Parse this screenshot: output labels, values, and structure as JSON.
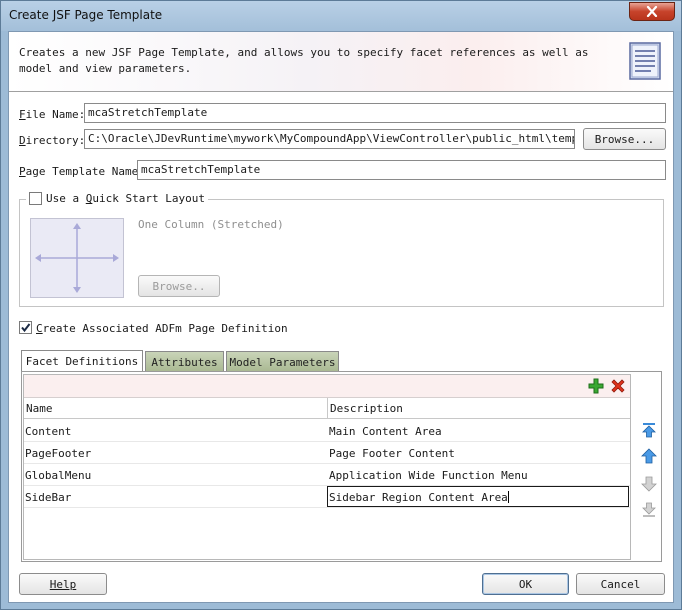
{
  "window": {
    "title": "Create JSF Page Template"
  },
  "header": {
    "description": "Creates a new JSF Page Template, and allows you to specify facet references as well as model and view parameters."
  },
  "file_name": {
    "label_key": "F",
    "label_rest": "ile Name:",
    "value": "mcaStretchTemplate"
  },
  "directory": {
    "label_key": "D",
    "label_rest": "irectory:",
    "value": "C:\\Oracle\\JDevRuntime\\mywork\\MyCompoundApp\\ViewController\\public_html\\templates",
    "browse_label": "Browse..."
  },
  "page_template_name": {
    "label_key": "P",
    "label_rest": "age Template Name:",
    "value": "mcaStretchTemplate"
  },
  "quick_start": {
    "label_pre": "Use a ",
    "label_key": "Q",
    "label_rest": "uick Start Layout",
    "checked": false,
    "layout_name": "One Column (Stretched)",
    "browse_label": "Browse.."
  },
  "adfm": {
    "label_key": "C",
    "label_rest": "reate Associated ADFm Page Definition",
    "checked": true
  },
  "tabs": [
    {
      "label": "Facet Definitions",
      "active": true
    },
    {
      "label": "Attributes",
      "active": false
    },
    {
      "label": "Model Parameters",
      "active": false
    }
  ],
  "table": {
    "columns": [
      "Name",
      "Description"
    ],
    "rows": [
      {
        "name": "Content",
        "description": "Main Content Area"
      },
      {
        "name": "PageFooter",
        "description": "Page Footer Content"
      },
      {
        "name": "GlobalMenu",
        "description": "Application Wide Function Menu"
      },
      {
        "name": "SideBar",
        "description": "Sidebar Region Content Area"
      }
    ]
  },
  "footer": {
    "help_label": "Help",
    "ok_label": "OK",
    "cancel_label": "Cancel"
  },
  "colors": {
    "titlebar": "#a9c4dd",
    "close": "#c7432b",
    "tab_inactive": "#b3c09c",
    "toolbar": "#fbefef"
  },
  "icons": [
    "close-icon",
    "document-icon",
    "add-icon",
    "delete-icon",
    "move-top-icon",
    "move-up-icon",
    "move-down-icon",
    "move-bottom-icon"
  ]
}
